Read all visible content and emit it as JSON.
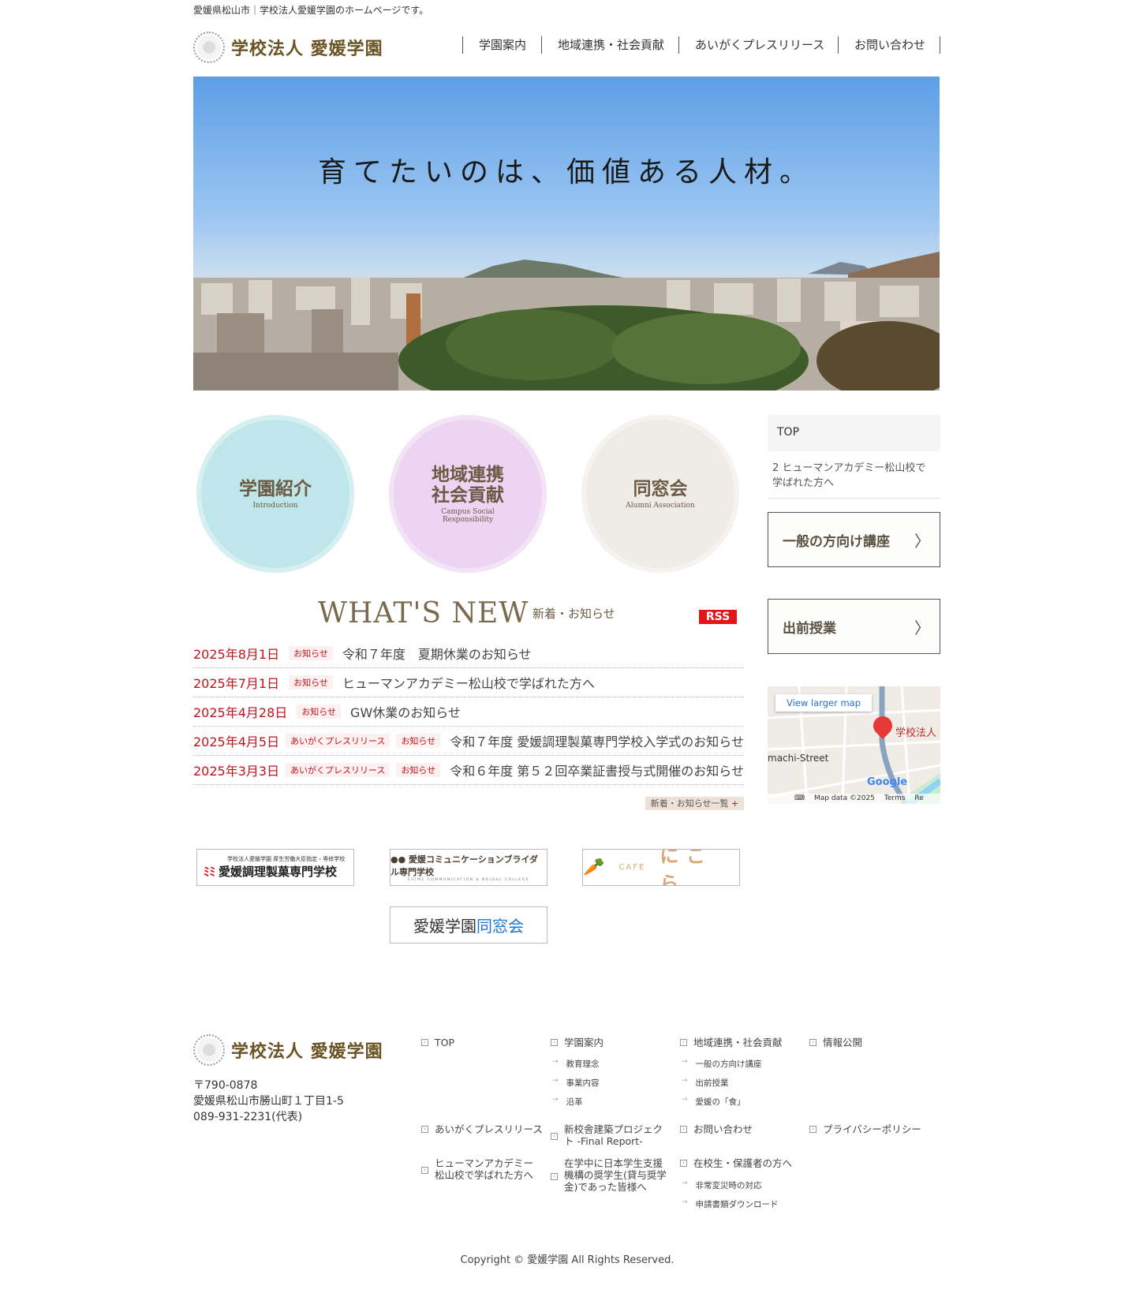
{
  "header": {
    "tagline": "愛媛県松山市｜学校法人愛媛学園のホームページです。",
    "logo": "学校法人 愛媛学園",
    "nav": [
      "学園案内",
      "地域連携・社会貢献",
      "あいがくプレスリリース",
      "お問い合わせ"
    ]
  },
  "hero": {
    "headline": "育てたいのは、価値ある人材。"
  },
  "circles": [
    {
      "jp": "学園紹介",
      "en": "Introduction"
    },
    {
      "jp": "地域連携\n社会貢献",
      "jp1": "地域連携",
      "jp2": "社会貢献",
      "en1": "Campus Social",
      "en2": "Responsibility"
    },
    {
      "jp": "同窓会",
      "en": "Alumni Association"
    }
  ],
  "sidebar": {
    "crumb_top": "TOP",
    "crumb_current": "2 ヒューマンアカデミー松山校で学ばれた方へ",
    "btn1": "一般の方向け講座",
    "btn2": "出前授業",
    "map": {
      "link": "View larger map",
      "place": "学校法人",
      "street": "machi-Street",
      "google": "Google",
      "data": "Map data ©2025",
      "terms": "Terms",
      "report": "Re"
    }
  },
  "news": {
    "title": "WHAT'S NEW",
    "subtitle": "新着・お知らせ",
    "rss": "RSS",
    "more": "新着・お知らせ一覧",
    "more_icon": "+",
    "items": [
      {
        "date": "2025年8月1日",
        "tags": [
          "お知らせ"
        ],
        "title": "令和７年度　夏期休業のお知らせ"
      },
      {
        "date": "2025年7月1日",
        "tags": [
          "お知らせ"
        ],
        "title": "ヒューマンアカデミー松山校で学ばれた方へ"
      },
      {
        "date": "2025年4月28日",
        "tags": [
          "お知らせ"
        ],
        "title": "GW休業のお知らせ"
      },
      {
        "date": "2025年4月5日",
        "tags": [
          "あいがくプレスリリース",
          "お知らせ"
        ],
        "title": "令和７年度 愛媛調理製菓専門学校入学式のお知らせ"
      },
      {
        "date": "2025年3月3日",
        "tags": [
          "あいがくプレスリリース",
          "お知らせ"
        ],
        "title": "令和６年度 第５２回卒業証書授与式開催のお知らせ"
      }
    ]
  },
  "banners": {
    "b1_small": "学校法人愛媛学園 厚生労働大臣指定・専修学校",
    "b1": "愛媛調理製菓専門学校",
    "b2": "愛媛コミュニケーションブライダル専門学校",
    "b2_en": "EHIME COMMUNICATION & BRIDAL COLLEGE",
    "b3_cafe": "CAFE",
    "b3": "にこら",
    "b4a": "愛媛学園",
    "b4b": "同窓会"
  },
  "footer": {
    "logo": "学校法人 愛媛学園",
    "zip": "〒790-0878",
    "address": "愛媛県松山市勝山町１丁目1-5",
    "tel": "089-931-2231(代表)",
    "links": {
      "top": "TOP",
      "about": "学園案内",
      "about_sub": [
        "教育理念",
        "事業内容",
        "沿革"
      ],
      "csr": "地域連携・社会貢献",
      "csr_sub": [
        "一般の方向け講座",
        "出前授業",
        "愛媛の「食」"
      ],
      "info": "情報公開",
      "press": "あいがくプレスリリース",
      "project": "新校舎建築プロジェクト -Final Report-",
      "contact": "お問い合わせ",
      "privacy": "プライバシーポリシー",
      "human": "ヒューマンアカデミー松山校で学ばれた方へ",
      "jasso": "在学中に日本学生支援機構の奨学生(貸与奨学金)であった皆様へ",
      "students": "在校生・保護者の方へ",
      "students_sub": [
        "非常変災時の対応",
        "申請書類ダウンロード"
      ]
    },
    "copyright": "Copyright © 愛媛学園 All Rights Reserved."
  }
}
